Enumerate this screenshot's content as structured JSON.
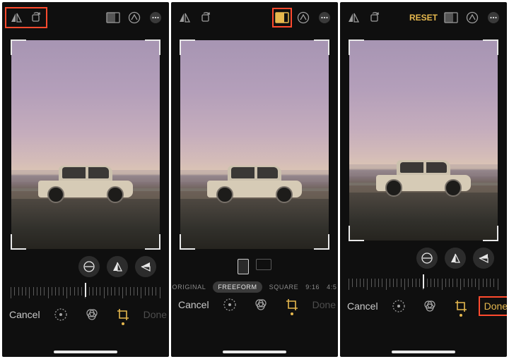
{
  "panel1": {
    "cancel": "Cancel",
    "done": "Done"
  },
  "panel2": {
    "cancel": "Cancel",
    "done": "Done",
    "aspects": {
      "original": "ORIGINAL",
      "freeform": "FREEFORM",
      "square": "SQUARE",
      "r916": "9:16",
      "r45": "4:5"
    }
  },
  "panel3": {
    "reset": "RESET",
    "cancel": "Cancel",
    "done": "Done"
  }
}
